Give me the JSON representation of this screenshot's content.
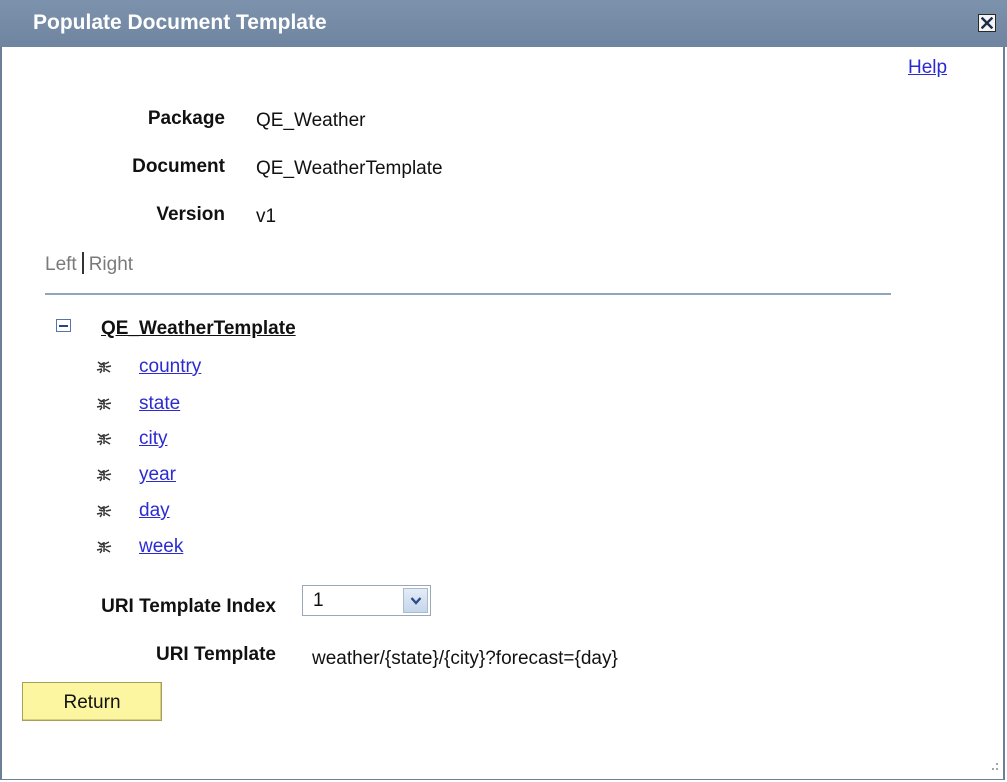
{
  "dialog": {
    "title": "Populate Document Template",
    "help_label": "Help"
  },
  "fields": {
    "package_label": "Package",
    "package_value": "QE_Weather",
    "document_label": "Document",
    "document_value": "QE_WeatherTemplate",
    "version_label": "Version",
    "version_value": "v1"
  },
  "view_toggle": {
    "left_label": "Left",
    "right_label": "Right"
  },
  "tree": {
    "root_label": "QE_WeatherTemplate",
    "items": [
      {
        "label": "country",
        "icon": "element-node-icon"
      },
      {
        "label": "state",
        "icon": "element-node-icon"
      },
      {
        "label": "city",
        "icon": "element-node-icon"
      },
      {
        "label": "year",
        "icon": "element-node-icon"
      },
      {
        "label": "day",
        "icon": "element-node-icon"
      },
      {
        "label": "week",
        "icon": "element-node-icon"
      }
    ]
  },
  "uri": {
    "index_label": "URI Template Index",
    "index_value": "1",
    "template_label": "URI Template",
    "template_value": "weather/{state}/{city}?forecast={day}"
  },
  "actions": {
    "return_label": "Return"
  },
  "colors": {
    "titlebar": "#7489a3",
    "link": "#2b2bd0",
    "return_button": "#fcf6a0",
    "divider": "#8fa6bf"
  }
}
